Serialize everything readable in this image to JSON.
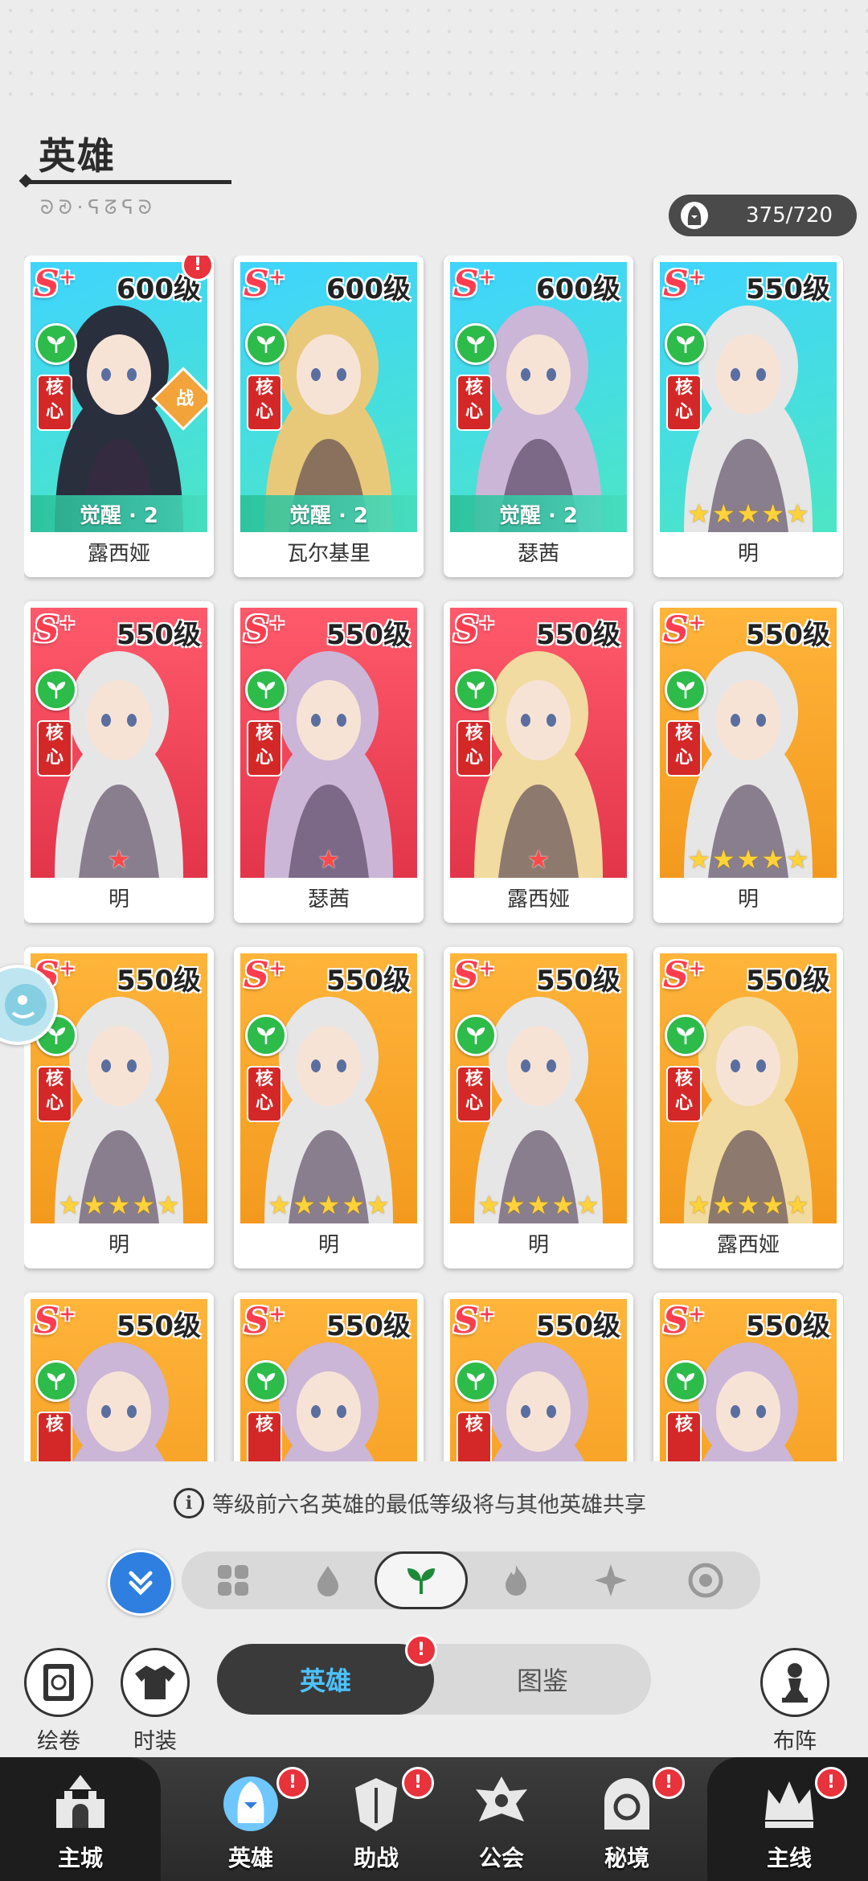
{
  "header": {
    "title": "英雄",
    "subtitle_glyphs": "ᘐᘑ·ᕋᘔᕋᘐ"
  },
  "counter": {
    "value": "375/720"
  },
  "heroes": [
    {
      "name": "露西娅",
      "rank": "S",
      "level": "600级",
      "bg": "cyan",
      "bottom": "awaken",
      "bottom_text": "觉醒 · 2",
      "badge": "!",
      "war": "战",
      "core": "核心"
    },
    {
      "name": "瓦尔基里",
      "rank": "S",
      "level": "600级",
      "bg": "cyan",
      "bottom": "awaken",
      "bottom_text": "觉醒 · 2",
      "core": "核心"
    },
    {
      "name": "瑟茜",
      "rank": "S",
      "level": "600级",
      "bg": "cyan",
      "bottom": "awaken",
      "bottom_text": "觉醒 · 2",
      "core": "核心"
    },
    {
      "name": "明",
      "rank": "S",
      "level": "550级",
      "bg": "cyan",
      "bottom": "stars",
      "stars": 5,
      "core": "核心"
    },
    {
      "name": "明",
      "rank": "S",
      "level": "550级",
      "bg": "red",
      "bottom": "redstar",
      "stars": 1,
      "core": "核心"
    },
    {
      "name": "瑟茜",
      "rank": "S",
      "level": "550级",
      "bg": "red",
      "bottom": "redstar",
      "stars": 1,
      "core": "核心"
    },
    {
      "name": "露西娅",
      "rank": "S",
      "level": "550级",
      "bg": "red",
      "bottom": "redstar",
      "stars": 1,
      "core": "核心"
    },
    {
      "name": "明",
      "rank": "S",
      "level": "550级",
      "bg": "gold",
      "bottom": "stars",
      "stars": 5,
      "core": "核心"
    },
    {
      "name": "明",
      "rank": "S",
      "level": "550级",
      "bg": "gold",
      "bottom": "stars",
      "stars": 5,
      "core": "核心"
    },
    {
      "name": "明",
      "rank": "S",
      "level": "550级",
      "bg": "gold",
      "bottom": "stars",
      "stars": 5,
      "core": "核心"
    },
    {
      "name": "明",
      "rank": "S",
      "level": "550级",
      "bg": "gold",
      "bottom": "stars",
      "stars": 5,
      "core": "核心"
    },
    {
      "name": "露西娅",
      "rank": "S",
      "level": "550级",
      "bg": "gold",
      "bottom": "stars",
      "stars": 5,
      "core": "核心"
    },
    {
      "name": "",
      "rank": "S",
      "level": "550级",
      "bg": "gold",
      "bottom": "none",
      "core": "核"
    },
    {
      "name": "",
      "rank": "S",
      "level": "550级",
      "bg": "gold",
      "bottom": "none",
      "core": "核"
    },
    {
      "name": "",
      "rank": "S",
      "level": "550级",
      "bg": "gold",
      "bottom": "none",
      "core": "核"
    },
    {
      "name": "",
      "rank": "S",
      "level": "550级",
      "bg": "gold",
      "bottom": "none",
      "core": "核"
    }
  ],
  "info": {
    "text": "等级前六名英雄的最低等级将与其他英雄共享"
  },
  "filters": [
    {
      "icon": "all-grid-icon"
    },
    {
      "icon": "water-drop-icon"
    },
    {
      "icon": "leaf-icon",
      "active": true
    },
    {
      "icon": "fire-icon"
    },
    {
      "icon": "light-icon"
    },
    {
      "icon": "dark-icon"
    }
  ],
  "tools": {
    "scroll_label": "绘卷",
    "costume_label": "时装",
    "tab_heroes": "英雄",
    "tab_collection": "图鉴",
    "formation_label": "布阵"
  },
  "nav": [
    {
      "label": "主城",
      "icon": "castle-icon",
      "badge": false
    },
    {
      "label": "英雄",
      "icon": "hero-icon",
      "badge": true,
      "active": true
    },
    {
      "label": "助战",
      "icon": "armor-icon",
      "badge": true
    },
    {
      "label": "公会",
      "icon": "guild-icon",
      "badge": false
    },
    {
      "label": "秘境",
      "icon": "portal-icon",
      "badge": true
    },
    {
      "label": "主线",
      "icon": "crown-icon",
      "badge": true
    }
  ],
  "colors": {
    "accent": "#2e7fe0",
    "red_badge": "#e8323c",
    "leaf": "#2dbb4a",
    "active_tab_text": "#4cc2ff"
  }
}
